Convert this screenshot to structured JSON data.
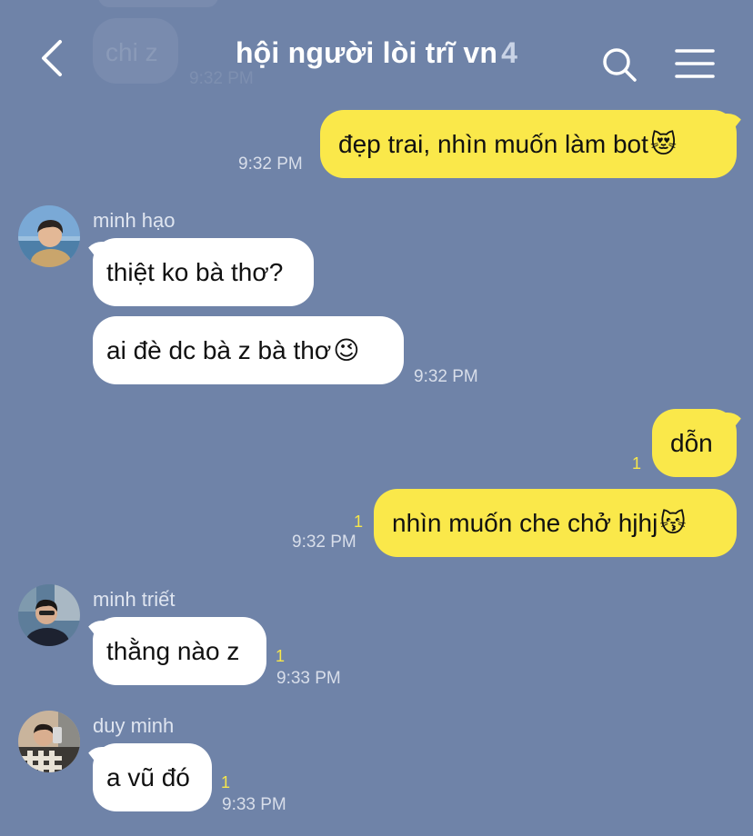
{
  "header": {
    "title": "hội người lòi trĩ vn",
    "member_count": "4"
  },
  "faded": {
    "message": "chi z",
    "time": "9:32 PM"
  },
  "messages": [
    {
      "from": "me",
      "text": "đẹp trai, nhìn muốn làm bot",
      "emoji": "😻",
      "time": "9:32 PM"
    },
    {
      "sender": "minh hạo",
      "text": "thiệt ko bà thơ?"
    },
    {
      "text": "ai đè dc bà z bà thơ",
      "emoji": "😉",
      "time": "9:32 PM"
    },
    {
      "from": "me",
      "text": "dỗn",
      "unread": "1"
    },
    {
      "from": "me",
      "text": "nhìn muốn che chở hjhj",
      "emoji": "😽",
      "unread": "1",
      "time": "9:32 PM"
    },
    {
      "sender": "minh triết",
      "text": "thằng nào z",
      "unread": "1",
      "time": "9:33 PM"
    },
    {
      "sender": "duy minh",
      "text": "a vũ đó",
      "unread": "1",
      "time": "9:33 PM"
    }
  ],
  "colors": {
    "background": "#6f83a8",
    "my_bubble": "#fae84a",
    "their_bubble": "#ffffff",
    "unread": "#f7e64a"
  },
  "icons": [
    "back-arrow-icon",
    "search-icon",
    "menu-icon"
  ]
}
